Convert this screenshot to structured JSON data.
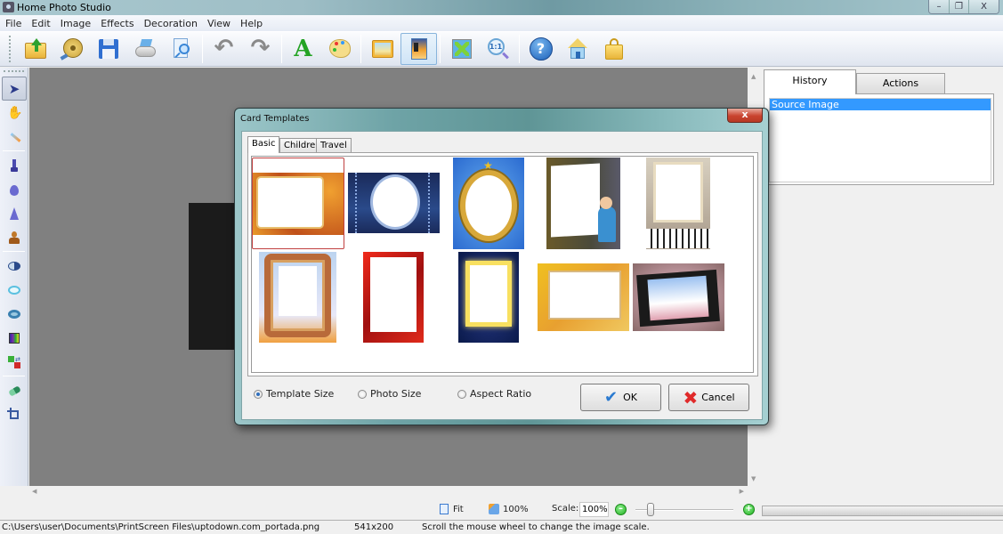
{
  "window": {
    "title": "Home Photo Studio",
    "controls": {
      "minimize": "–",
      "restore": "❐",
      "close": "X"
    }
  },
  "menu": [
    "File",
    "Edit",
    "Image",
    "Effects",
    "Decoration",
    "View",
    "Help"
  ],
  "toolbar": [
    {
      "name": "open-icon",
      "label": "Open"
    },
    {
      "name": "film-reel-icon",
      "label": "Slideshow"
    },
    {
      "name": "save-icon",
      "label": "Save"
    },
    {
      "name": "print-icon",
      "label": "Print"
    },
    {
      "name": "print-preview-icon",
      "label": "Print Preview"
    },
    {
      "name": "undo-icon",
      "label": "Undo"
    },
    {
      "name": "redo-icon",
      "label": "Redo"
    },
    {
      "name": "text-icon",
      "label": "Text",
      "glyph": "A"
    },
    {
      "name": "palette-icon",
      "label": "Colors"
    },
    {
      "name": "frame-icon",
      "label": "Frames"
    },
    {
      "name": "card-template-icon",
      "label": "Card Templates"
    },
    {
      "name": "fit-to-window-icon",
      "label": "Fit"
    },
    {
      "name": "actual-size-icon",
      "label": "1:1",
      "glyph": "1:1"
    },
    {
      "name": "help-icon",
      "label": "Help",
      "glyph": "?"
    },
    {
      "name": "home-icon",
      "label": "Home"
    },
    {
      "name": "buy-icon",
      "label": "Buy"
    }
  ],
  "tools": [
    {
      "name": "pointer-tool-icon",
      "selected": true
    },
    {
      "name": "hand-tool-icon"
    },
    {
      "name": "magic-wand-tool-icon"
    },
    {
      "name": "brush-tool-icon"
    },
    {
      "name": "blur-tool-icon"
    },
    {
      "name": "sharpen-tool-icon"
    },
    {
      "name": "clone-stamp-tool-icon"
    },
    {
      "name": "contrast-tool-icon"
    },
    {
      "name": "lighten-tool-icon"
    },
    {
      "name": "darken-tool-icon"
    },
    {
      "name": "color-balance-tool-icon"
    },
    {
      "name": "color-replace-tool-icon"
    },
    {
      "name": "eraser-tool-icon"
    },
    {
      "name": "crop-tool-icon"
    }
  ],
  "right_panel": {
    "tabs": [
      "History",
      "Actions"
    ],
    "active_tab": "History",
    "history": [
      "Source Image"
    ]
  },
  "dialog": {
    "title": "Card Templates",
    "close_label": "x",
    "tabs": [
      "Basic",
      "Children",
      "Travel"
    ],
    "active_tab": "Basic",
    "templates": [
      {
        "name": "autumn-leaves-frame",
        "selected": true
      },
      {
        "name": "moon-night-frame"
      },
      {
        "name": "golden-oval-mirror-frame"
      },
      {
        "name": "painter-easel-frame"
      },
      {
        "name": "piano-vintage-frame"
      },
      {
        "name": "ornate-baroque-frame"
      },
      {
        "name": "red-chain-frame"
      },
      {
        "name": "starry-night-frame"
      },
      {
        "name": "yellow-autumn-frame"
      },
      {
        "name": "filmstrip-flowers-frame"
      }
    ],
    "options": [
      {
        "label": "Template Size",
        "checked": true
      },
      {
        "label": "Photo Size",
        "checked": false
      },
      {
        "label": "Aspect Ratio",
        "checked": false
      }
    ],
    "ok_label": "OK",
    "cancel_label": "Cancel"
  },
  "zoombar": {
    "fit_label": "Fit",
    "actual_label": "100%",
    "scale_label": "Scale:",
    "scale_value": "100%",
    "zoom_level_fraction": 0.15
  },
  "status": {
    "path": "C:\\Users\\user\\Documents\\PrintScreen Files\\uptodown.com_portada.png",
    "dimensions": "541x200",
    "hint": "Scroll the mouse wheel to change the image scale."
  }
}
